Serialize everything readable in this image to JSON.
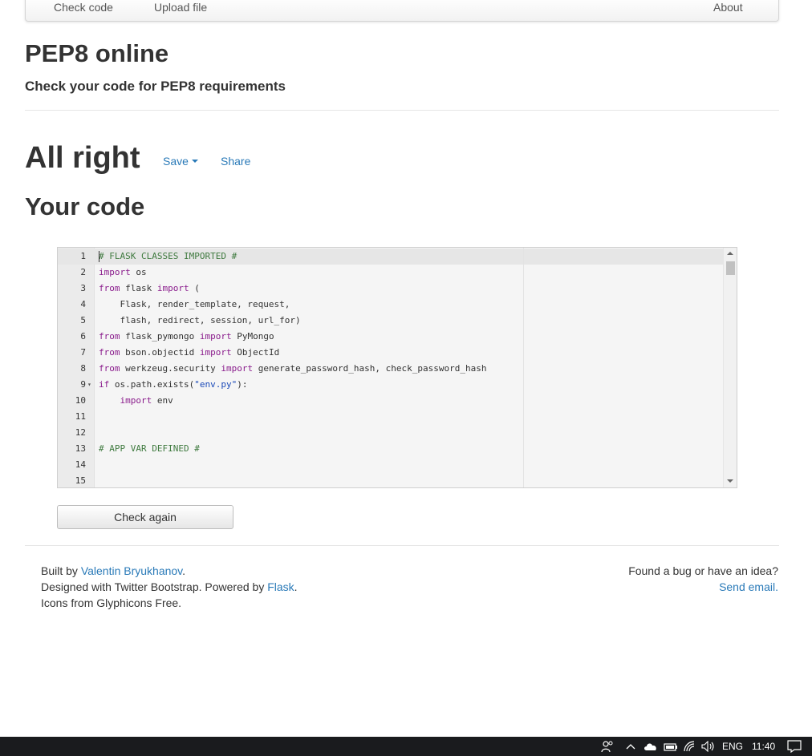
{
  "navbar": {
    "items": [
      {
        "label": "Check code"
      },
      {
        "label": "Upload file"
      },
      {
        "label": "About"
      }
    ]
  },
  "header": {
    "title": "PEP8 online",
    "subtitle": "Check your code for PEP8 requirements"
  },
  "result": {
    "title": "All right",
    "save_label": "Save",
    "share_label": "Share"
  },
  "code_section": {
    "title": "Your code",
    "lines": [
      {
        "n": "1",
        "code": "# FLASK CLASSES IMPORTED #"
      },
      {
        "n": "2",
        "code": "import os"
      },
      {
        "n": "3",
        "code": "from flask import ("
      },
      {
        "n": "4",
        "code": "    Flask, render_template, request,"
      },
      {
        "n": "5",
        "code": "    flash, redirect, session, url_for)"
      },
      {
        "n": "6",
        "code": "from flask_pymongo import PyMongo"
      },
      {
        "n": "7",
        "code": "from bson.objectid import ObjectId"
      },
      {
        "n": "8",
        "code": "from werkzeug.security import generate_password_hash, check_password_hash"
      },
      {
        "n": "9",
        "code": "if os.path.exists(\"env.py\"):"
      },
      {
        "n": "10",
        "code": "    import env"
      },
      {
        "n": "11",
        "code": ""
      },
      {
        "n": "12",
        "code": ""
      },
      {
        "n": "13",
        "code": "# APP VAR DEFINED #"
      },
      {
        "n": "14",
        "code": ""
      },
      {
        "n": "15",
        "code": ""
      }
    ],
    "check_again_label": "Check again"
  },
  "footer": {
    "built_by_prefix": "Built by ",
    "author": "Valentin Bryukhanov",
    "period": ".",
    "designed_prefix": "Designed with Twitter Bootstrap. Powered by ",
    "framework": "Flask",
    "icons_text": "Icons from Glyphicons Free.",
    "bug_text": "Found a bug or have an idea?",
    "send_email": "Send email."
  },
  "taskbar": {
    "language": "ENG",
    "time": "11:40",
    "icons": [
      "people-icon",
      "chevron-up-icon",
      "cloud-icon",
      "battery-icon",
      "wifi-icon",
      "volume-icon",
      "notification-icon"
    ]
  },
  "colors": {
    "link": "#2a7ab8",
    "keyword": "#8a1c8c",
    "comment": "#3f7a3f",
    "string": "#1a49b8",
    "taskbar": "#1a1b1e"
  }
}
